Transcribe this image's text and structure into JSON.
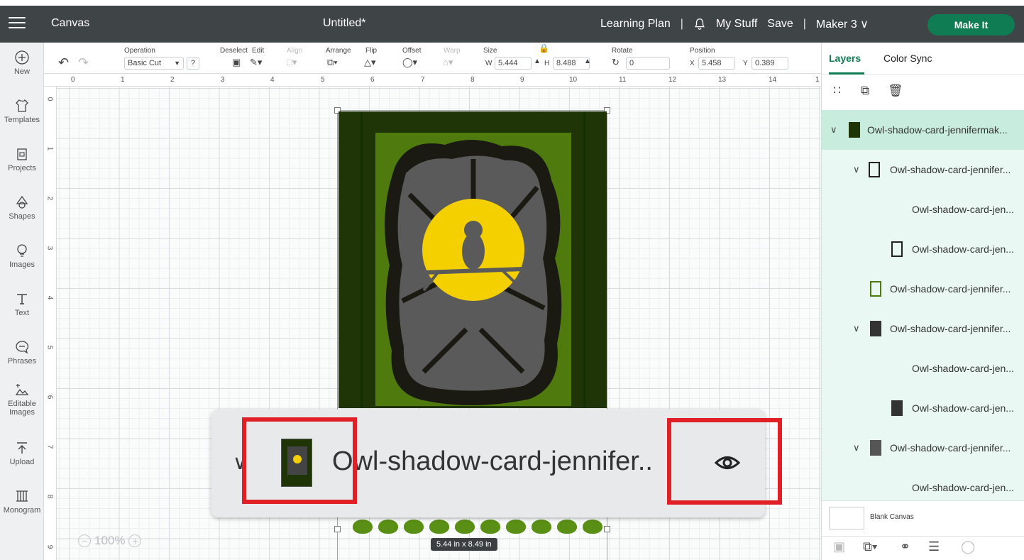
{
  "topbar": {
    "app_name": "Canvas",
    "doc_title": "Untitled*",
    "learning_plan": "Learning Plan",
    "sep": "|",
    "my_stuff": "My Stuff",
    "save": "Save",
    "machine": "Maker 3 ∨",
    "make_it": "Make It"
  },
  "tools": [
    {
      "label": "New",
      "icon": "plus-circle-icon"
    },
    {
      "label": "Templates",
      "icon": "shirt-icon"
    },
    {
      "label": "Projects",
      "icon": "clipboard-icon"
    },
    {
      "label": "Shapes",
      "icon": "shapes-icon"
    },
    {
      "label": "Images",
      "icon": "lightbulb-icon"
    },
    {
      "label": "Text",
      "icon": "text-icon"
    },
    {
      "label": "Phrases",
      "icon": "speech-bubble-icon"
    },
    {
      "label": "Editable Images",
      "icon": "edit-image-icon"
    },
    {
      "label": "Upload",
      "icon": "upload-icon"
    },
    {
      "label": "Monogram",
      "icon": "monogram-icon"
    }
  ],
  "toolbar": {
    "operation_label": "Operation",
    "operation_value": "Basic Cut",
    "help": "?",
    "deselect": "Deselect",
    "edit": "Edit",
    "align": "Align",
    "arrange": "Arrange",
    "flip": "Flip",
    "offset": "Offset",
    "warp": "Warp",
    "size_label": "Size",
    "w_label": "W",
    "w_value": "5.444",
    "h_label": "H",
    "h_value": "8.488",
    "rotate_label": "Rotate",
    "rotate_value": "0",
    "position_label": "Position",
    "x_label": "X",
    "x_value": "5.458",
    "y_label": "Y",
    "y_value": "0.389"
  },
  "rulers": {
    "top": [
      "0",
      "1",
      "2",
      "3",
      "4",
      "5",
      "6",
      "7",
      "8",
      "9",
      "10",
      "11",
      "12",
      "13",
      "14",
      "1"
    ],
    "left": [
      "0",
      "1",
      "2",
      "3",
      "4",
      "5",
      "6",
      "7",
      "8",
      "9"
    ]
  },
  "canvas": {
    "dimensions": "5.44  in x 8.49  in",
    "zoom": "100%"
  },
  "popup": {
    "layer_name": "Owl-shadow-card-jennifer..",
    "chevron": "∨"
  },
  "layers_panel": {
    "tab_layers": "Layers",
    "tab_color_sync": "Color Sync",
    "rows": [
      {
        "label": "Owl-shadow-card-jennifermak...",
        "chevron": "∨"
      },
      {
        "label": "Owl-shadow-card-jennifer...",
        "chevron": "∨"
      },
      {
        "label": "Owl-shadow-card-jen..."
      },
      {
        "label": "Owl-shadow-card-jen..."
      },
      {
        "label": "Owl-shadow-card-jennifer..."
      },
      {
        "label": "Owl-shadow-card-jennifer...",
        "chevron": "∨"
      },
      {
        "label": "Owl-shadow-card-jen..."
      },
      {
        "label": "Owl-shadow-card-jen..."
      },
      {
        "label": "Owl-shadow-card-jennifer...",
        "chevron": "∨"
      },
      {
        "label": "Owl-shadow-card-jen..."
      }
    ],
    "blank_canvas": "Blank Canvas"
  },
  "colors": {
    "topbar": "#3f4547",
    "make_it": "#0f7c53",
    "card_dark": "#1f3407",
    "card_green": "#4e7a0e",
    "moon": "#f4d000",
    "rock": "#5a5a5a",
    "highlight": "#e11f26"
  }
}
